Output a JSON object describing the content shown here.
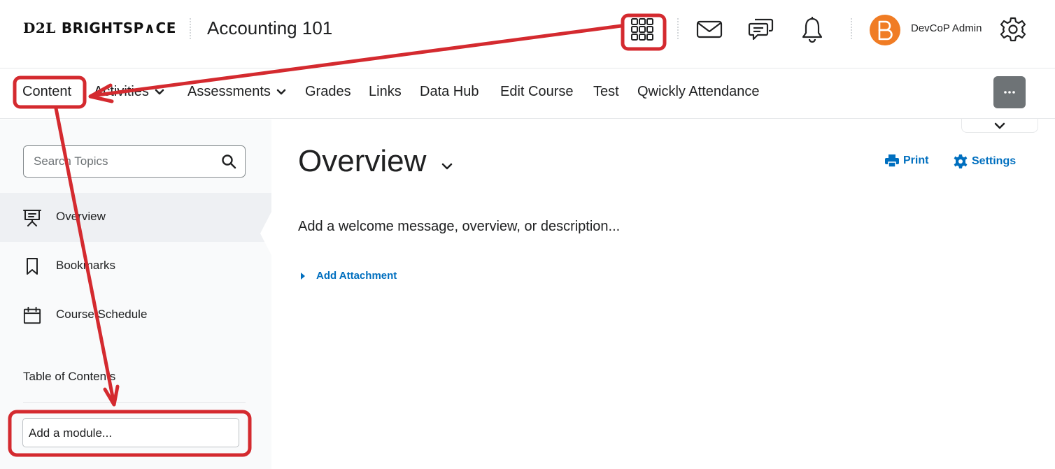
{
  "header": {
    "logo_mark": "D2L",
    "logo_brand": "BRIGHTSP∧CE",
    "course_title": "Accounting 101",
    "icons": [
      "app-launcher-icon",
      "mail-icon",
      "chat-icon",
      "bell-icon",
      "gear-icon"
    ],
    "user_name": "DevCoP Admin",
    "avatar_color": "#f07c24"
  },
  "navbar": {
    "items": [
      {
        "label": "Content"
      },
      {
        "label": "Activities",
        "dropdown": true
      },
      {
        "label": "Assessments",
        "dropdown": true
      },
      {
        "label": "Grades"
      },
      {
        "label": "Links"
      },
      {
        "label": "Data Hub"
      },
      {
        "label": "Edit Course"
      },
      {
        "label": "Test"
      },
      {
        "label": "Qwickly Attendance"
      }
    ],
    "more_label": "···"
  },
  "sidebar": {
    "search_placeholder": "Search Topics",
    "items": [
      {
        "label": "Overview",
        "icon": "presentation-icon",
        "active": true
      },
      {
        "label": "Bookmarks",
        "icon": "bookmark-icon"
      },
      {
        "label": "Course Schedule",
        "icon": "calendar-icon"
      }
    ],
    "toc_label": "Table of Contents",
    "add_module_placeholder": "Add a module..."
  },
  "main": {
    "title": "Overview",
    "print_label": "Print",
    "settings_label": "Settings",
    "welcome_text": "Add a welcome message, overview, or description...",
    "add_attachment_label": "Add Attachment"
  },
  "colors": {
    "link_blue": "#006fbf",
    "annotation_red": "#d42a2f",
    "more_button": "#6e7376"
  }
}
